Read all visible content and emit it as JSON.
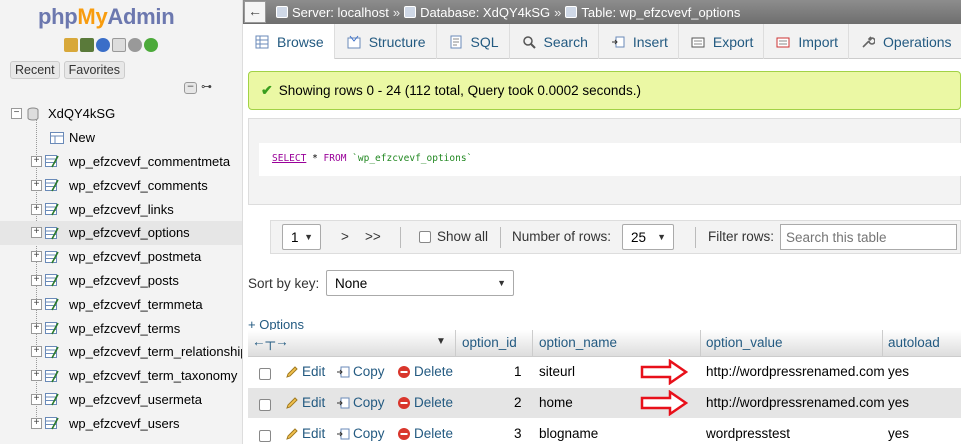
{
  "nav": {
    "logo_php": "php",
    "logo_my": "My",
    "logo_admin": "Admin",
    "recent_tab": "Recent",
    "favorites_tab": "Favorites",
    "database": "XdQY4kSG",
    "new_label": "New",
    "tables": [
      "wp_efzcvevf_commentmeta",
      "wp_efzcvevf_comments",
      "wp_efzcvevf_links",
      "wp_efzcvevf_options",
      "wp_efzcvevf_postmeta",
      "wp_efzcvevf_posts",
      "wp_efzcvevf_termmeta",
      "wp_efzcvevf_terms",
      "wp_efzcvevf_term_relationships",
      "wp_efzcvevf_term_taxonomy",
      "wp_efzcvevf_usermeta",
      "wp_efzcvevf_users"
    ],
    "active_table": "wp_efzcvevf_options"
  },
  "breadcrumb": {
    "server": "Server: localhost",
    "database": "Database: XdQY4kSG",
    "table": "Table: wp_efzcvevf_options",
    "separator": "»"
  },
  "menu": {
    "tabs": [
      "Browse",
      "Structure",
      "SQL",
      "Search",
      "Insert",
      "Export",
      "Import",
      "Operations"
    ],
    "active": "Browse"
  },
  "message": {
    "text": "Showing rows 0 - 24 (112 total, Query took 0.0002 seconds.)"
  },
  "sql": {
    "select": "SELECT",
    "star": "*",
    "from": "FROM",
    "table": "`wp_efzcvevf_options`"
  },
  "pagination": {
    "page": "1",
    "next": ">",
    "last": ">>",
    "show_all": "Show all",
    "rows_label": "Number of rows:",
    "rows_value": "25",
    "filter_label": "Filter rows:",
    "filter_placeholder": "Search this table"
  },
  "sort": {
    "label": "Sort by key:",
    "value": "None"
  },
  "options_link": "+ Options",
  "table": {
    "columns": [
      "option_id",
      "option_name",
      "option_value",
      "autoload"
    ],
    "actions": {
      "edit": "Edit",
      "copy": "Copy",
      "delete": "Delete"
    },
    "rows": [
      {
        "option_id": "1",
        "option_name": "siteurl",
        "option_value": "http://wordpressrenamed.com",
        "autoload": "yes",
        "highlighted": true
      },
      {
        "option_id": "2",
        "option_name": "home",
        "option_value": "http://wordpressrenamed.com",
        "autoload": "yes",
        "highlighted": true
      },
      {
        "option_id": "3",
        "option_name": "blogname",
        "option_value": "wordpresstest",
        "autoload": "yes",
        "highlighted": false
      }
    ]
  },
  "colors": {
    "link": "#235a81",
    "success_bg": "#ebf8a4",
    "success_border": "#a2d246",
    "annotation_arrow": "#e8101a",
    "logo_orange": "#f89c0e",
    "logo_blue": "#6c78af"
  }
}
